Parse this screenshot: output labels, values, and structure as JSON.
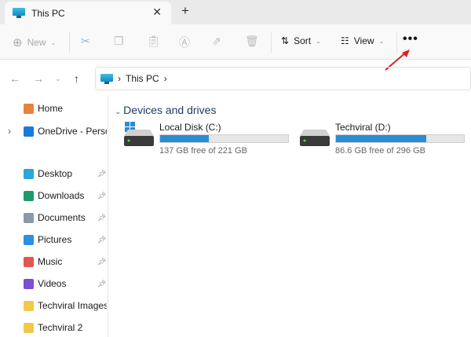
{
  "tab": {
    "title": "This PC",
    "close": "✕",
    "new_tab": "+"
  },
  "toolbar": {
    "new": "New",
    "sort": "Sort",
    "view": "View",
    "more": "•••"
  },
  "address": {
    "path": "This PC",
    "sep": "›"
  },
  "sidebar": {
    "items": [
      {
        "label": "Home",
        "icon": "home-icon",
        "color": "#e8833a"
      },
      {
        "label": "OneDrive - Personal",
        "icon": "onedrive-icon",
        "color": "#1b7ad8"
      },
      {
        "label": "Desktop",
        "icon": "desktop-icon",
        "color": "#2ba6d6",
        "pinned": true
      },
      {
        "label": "Downloads",
        "icon": "download-icon",
        "color": "#1d9a6c",
        "pinned": true
      },
      {
        "label": "Documents",
        "icon": "documents-icon",
        "color": "#8a9aa8",
        "pinned": true
      },
      {
        "label": "Pictures",
        "icon": "pictures-icon",
        "color": "#2d8fe0",
        "pinned": true
      },
      {
        "label": "Music",
        "icon": "music-icon",
        "color": "#e2574c",
        "pinned": true
      },
      {
        "label": "Videos",
        "icon": "videos-icon",
        "color": "#7a4fd1",
        "pinned": true
      },
      {
        "label": "Techviral Images",
        "icon": "folder-icon",
        "color": "#f2c94c"
      },
      {
        "label": "Techviral 2",
        "icon": "folder-icon",
        "color": "#f2c94c"
      }
    ]
  },
  "main": {
    "section": "Devices and drives",
    "drives": [
      {
        "name": "Local Disk (C:)",
        "free": "137 GB free of 221 GB",
        "used_fraction": 0.38,
        "bar_color": "#2a8dd4"
      },
      {
        "name": "Techviral (D:)",
        "free": "86.6 GB free of 296 GB",
        "used_fraction": 0.707,
        "bar_color": "#2a8dd4"
      }
    ]
  }
}
